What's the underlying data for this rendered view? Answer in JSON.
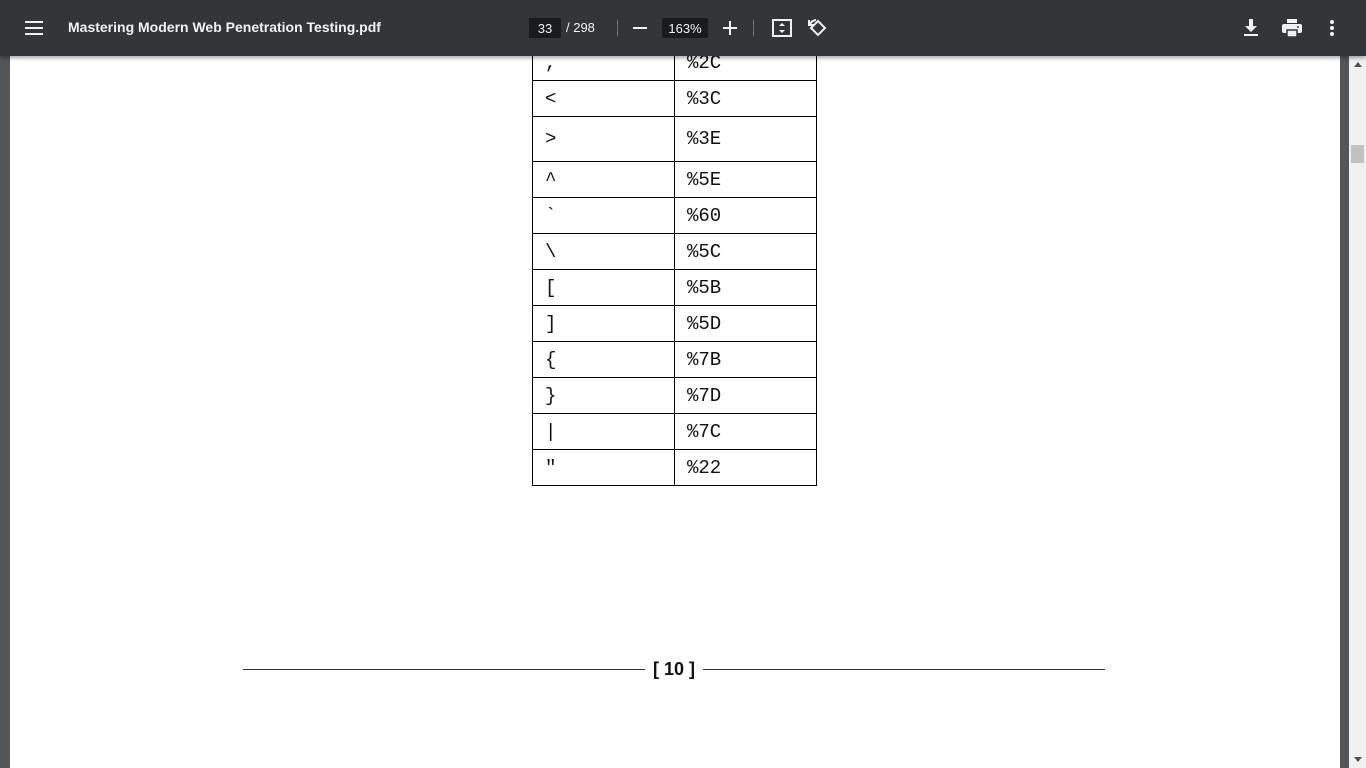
{
  "toolbar": {
    "title": "Mastering Modern Web Penetration Testing.pdf",
    "page_current": "33",
    "page_total": "/ 298",
    "zoom": "163%",
    "icons": {
      "menu": "hamburger-menu-icon",
      "zoom_out": "minus-icon",
      "zoom_in": "plus-icon",
      "fit": "fit-to-page-icon",
      "rotate": "rotate-icon",
      "download": "download-icon",
      "print": "print-icon",
      "more": "more-vertical-icon"
    }
  },
  "document": {
    "encoding_table": [
      {
        "char": ",",
        "code": "%2C"
      },
      {
        "char": "<",
        "code": "%3C"
      },
      {
        "char": ">",
        "code": "%3E"
      },
      {
        "char": "^",
        "code": "%5E"
      },
      {
        "char": "`",
        "code": "%60"
      },
      {
        "char": "\\",
        "code": "%5C"
      },
      {
        "char": "[",
        "code": "%5B"
      },
      {
        "char": "]",
        "code": "%5D"
      },
      {
        "char": "{",
        "code": "%7B"
      },
      {
        "char": "}",
        "code": "%7D"
      },
      {
        "char": "|",
        "code": "%7C"
      },
      {
        "char": "\"",
        "code": "%22"
      }
    ],
    "page_number": "[ 10 ]"
  },
  "colors": {
    "toolbar_bg": "#323639",
    "viewer_bg": "#525659",
    "page_bg": "#ffffff"
  }
}
